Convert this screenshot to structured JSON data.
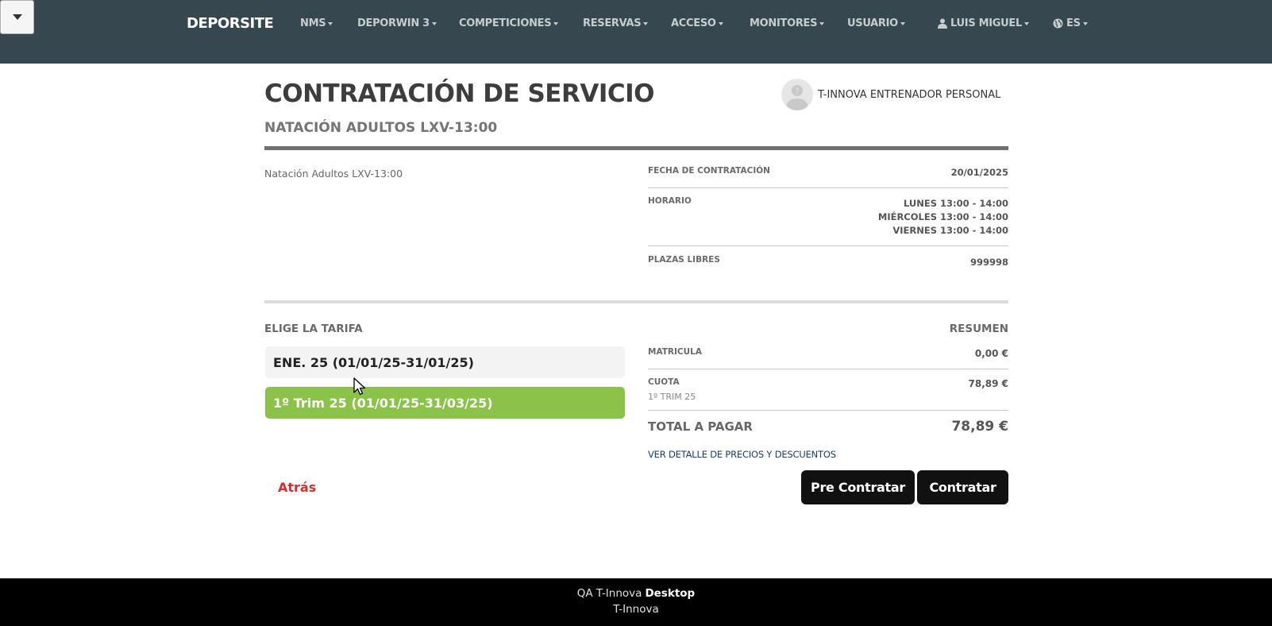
{
  "nav": {
    "brand": "DEPORSITE",
    "items": [
      "NMS",
      "DEPORWIN 3",
      "COMPETICIONES",
      "RESERVAS",
      "ACCESO",
      "MONITORES",
      "USUARIO"
    ],
    "user": "LUIS MIGUEL",
    "language": "ES"
  },
  "header": {
    "title": "CONTRATACIÓN DE SERVICIO",
    "subtitle": "NATACIÓN ADULTOS LXV-13:00",
    "trainer": "T-INNOVA ENTRENADOR PERSONAL"
  },
  "info": {
    "description": "Natación Adultos LXV-13:00",
    "fecha_label": "FECHA DE CONTRATACIÓN",
    "fecha_value": "20/01/2025",
    "horario_label": "HORARIO",
    "horario": [
      "LUNES 13:00 - 14:00",
      "MIÉRCOLES 13:00 - 14:00",
      "VIERNES 13:00 - 14:00"
    ],
    "plazas_label": "PLAZAS LIBRES",
    "plazas_value": "999998"
  },
  "tarifa": {
    "label": "ELIGE LA TARIFA",
    "options": [
      "ENE. 25 (01/01/25-31/01/25)",
      "1º Trim 25 (01/01/25-31/03/25)"
    ],
    "selected_index": 1
  },
  "resumen": {
    "label": "RESUMEN",
    "matricula_label": "MATRICULA",
    "matricula_value": "0,00 €",
    "cuota_label": "CUOTA",
    "cuota_sub": "1º TRIM 25",
    "cuota_value": "78,89 €",
    "total_label": "TOTAL A PAGAR",
    "total_value": "78,89 €",
    "detail_link": "VER DETALLE DE PRECIOS Y DESCUENTOS"
  },
  "actions": {
    "back": "Atrás",
    "pre_contract": "Pre Contratar",
    "contract": "Contratar"
  },
  "footer": {
    "line1_prefix": "QA T-Innova",
    "line1_bold": "Desktop",
    "line2": "T-Innova"
  },
  "colors": {
    "navbar": "#37474f",
    "selected_tariff": "#8bc34a",
    "back_link": "#d32f2f",
    "button": "#111111",
    "footer": "#000000"
  }
}
